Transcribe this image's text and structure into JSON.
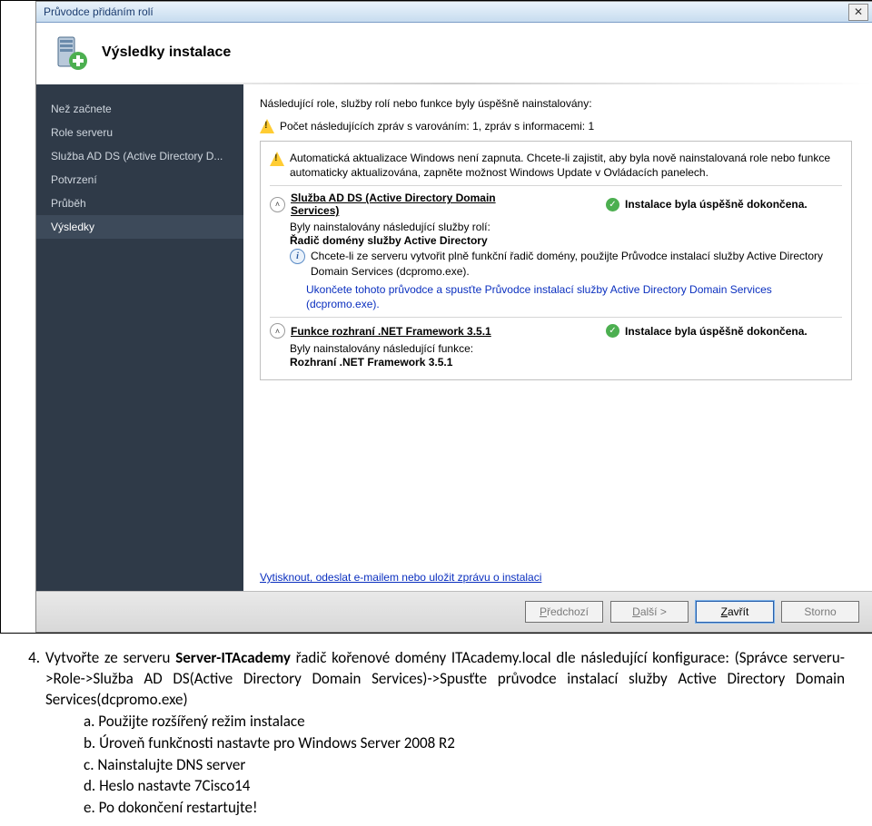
{
  "window": {
    "title": "Průvodce přidáním rolí",
    "header": "Výsledky instalace"
  },
  "sidebar": {
    "items": [
      {
        "label": "Než začnete"
      },
      {
        "label": "Role serveru"
      },
      {
        "label": "Služba AD DS (Active Directory D..."
      },
      {
        "label": "Potvrzení"
      },
      {
        "label": "Průběh"
      },
      {
        "label": "Výsledky"
      }
    ]
  },
  "main": {
    "intro": "Následující role, služby rolí nebo funkce byly úspěšně nainstalovány:",
    "warn_count": "Počet následujících zpráv s varováním: 1, zpráv s informacemi: 1",
    "panel": {
      "auto_update": "Automatická aktualizace Windows není zapnuta. Chcete-li zajistit, aby byla nově nainstalovaná role nebo funkce automaticky aktualizována, zapněte možnost Windows Update v Ovládacích panelech.",
      "adds_title": "Služba AD DS (Active Directory Domain Services)",
      "success": "Instalace byla úspěšně dokončena.",
      "roles_intro": "Byly nainstalovány následující služby rolí:",
      "dc_bold": "Řadič domény služby Active Directory",
      "dc_info": "Chcete-li ze serveru vytvořit plně funkční řadič domény, použijte Průvodce instalací služby Active Directory Domain Services (dcpromo.exe).",
      "dc_link": "Ukončete tohoto průvodce a spusťte Průvodce instalací služby Active Directory Domain Services (dcpromo.exe).",
      "netfx_title": "Funkce rozhraní .NET Framework 3.5.1",
      "funcs_intro": "Byly nainstalovány následující funkce:",
      "netfx_bold": "Rozhraní .NET Framework 3.5.1"
    },
    "print_link": "Vytisknout, odeslat e-mailem nebo uložit zprávu o instalaci"
  },
  "buttons": {
    "prev": "< Předchozí",
    "prev_u": "P",
    "next": "Další >",
    "next_u": "D",
    "close": "Zavřít",
    "close_u": "Z",
    "cancel": "Storno"
  },
  "doc": {
    "num": "4.",
    "line1_a": "Vytvořte ze serveru ",
    "line1_b": "Server-ITAcademy",
    "line1_c": " řadič kořenové domény ITAcademy.local dle následující konfigurace: (Správce serveru->Role->Služba AD DS(Active Directory Domain Services)->Spusťte průvodce instalací služby Active Directory Domain Services(dcpromo.exe)",
    "a": "a.  Použijte rozšířený režim instalace",
    "b": "b.  Úroveň funkčnosti nastavte pro Windows Server 2008 R2",
    "c": "c.  Nainstalujte DNS server",
    "d": "d.  Heslo nastavte 7Cisco14",
    "e": "e.  Po dokončení restartujte!"
  }
}
